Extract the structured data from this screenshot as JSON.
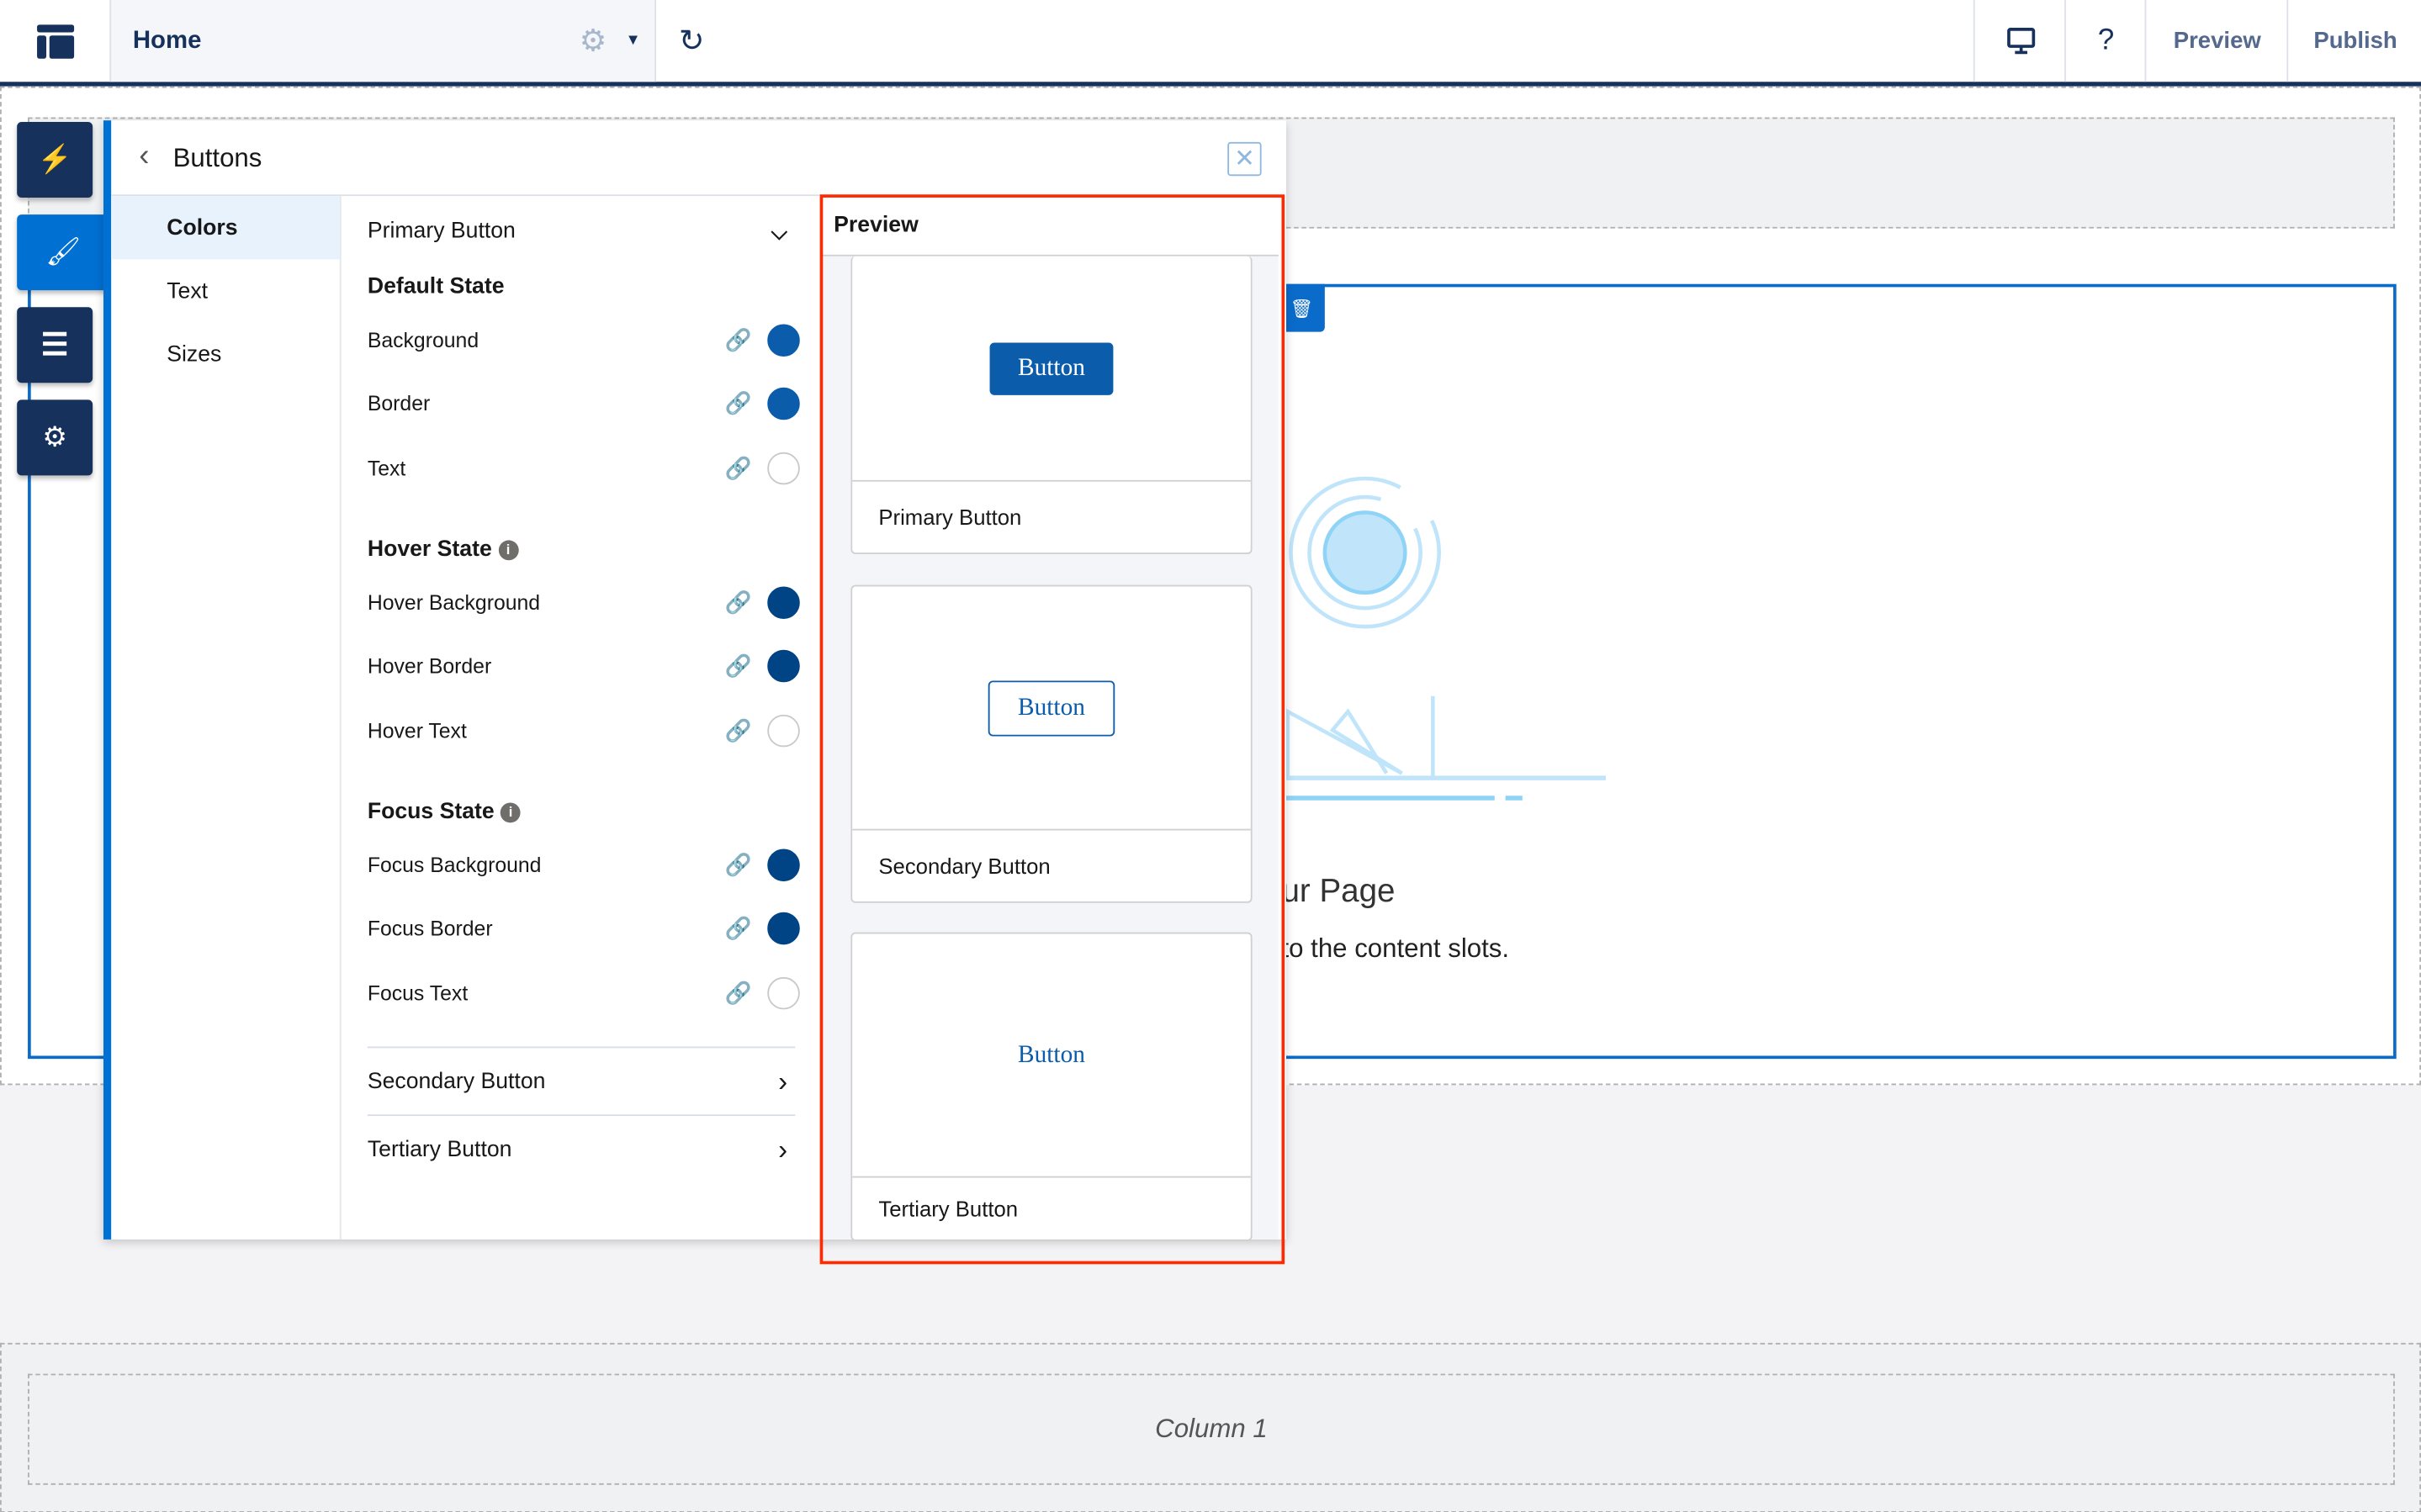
{
  "topbar": {
    "page": "Home",
    "preview": "Preview",
    "publish": "Publish",
    "help": "?"
  },
  "panel": {
    "title": "Buttons",
    "nav": [
      {
        "label": "Colors",
        "active": true
      },
      {
        "label": "Text"
      },
      {
        "label": "Sizes"
      }
    ],
    "primary_section": "Primary Button",
    "groups": [
      {
        "title": "Default State",
        "info": false,
        "items": [
          {
            "label": "Background",
            "color": "#0b5cab"
          },
          {
            "label": "Border",
            "color": "#0b5cab"
          },
          {
            "label": "Text",
            "color": "#ffffff"
          }
        ]
      },
      {
        "title": "Hover State",
        "info": true,
        "items": [
          {
            "label": "Hover Background",
            "color": "#014486"
          },
          {
            "label": "Hover Border",
            "color": "#014486"
          },
          {
            "label": "Hover Text",
            "color": "#ffffff"
          }
        ]
      },
      {
        "title": "Focus State",
        "info": true,
        "items": [
          {
            "label": "Focus Background",
            "color": "#014486"
          },
          {
            "label": "Focus Border",
            "color": "#014486"
          },
          {
            "label": "Focus Text",
            "color": "#ffffff"
          }
        ]
      }
    ],
    "secondary_section": "Secondary Button",
    "tertiary_section": "Tertiary Button"
  },
  "preview": {
    "title": "Preview",
    "cards": [
      {
        "button": "Button",
        "caption": "Primary Button"
      },
      {
        "button": "Button",
        "caption": "Secondary Button"
      },
      {
        "button": "Button",
        "caption": "Tertiary Button"
      }
    ]
  },
  "page": {
    "heading_fragment": "ur Page",
    "body_fragment": "to the content slots.",
    "column": "Column 1"
  },
  "colors": {
    "accent": "#0070d2",
    "navy": "#16325c",
    "highlight": "#ff2a00"
  }
}
